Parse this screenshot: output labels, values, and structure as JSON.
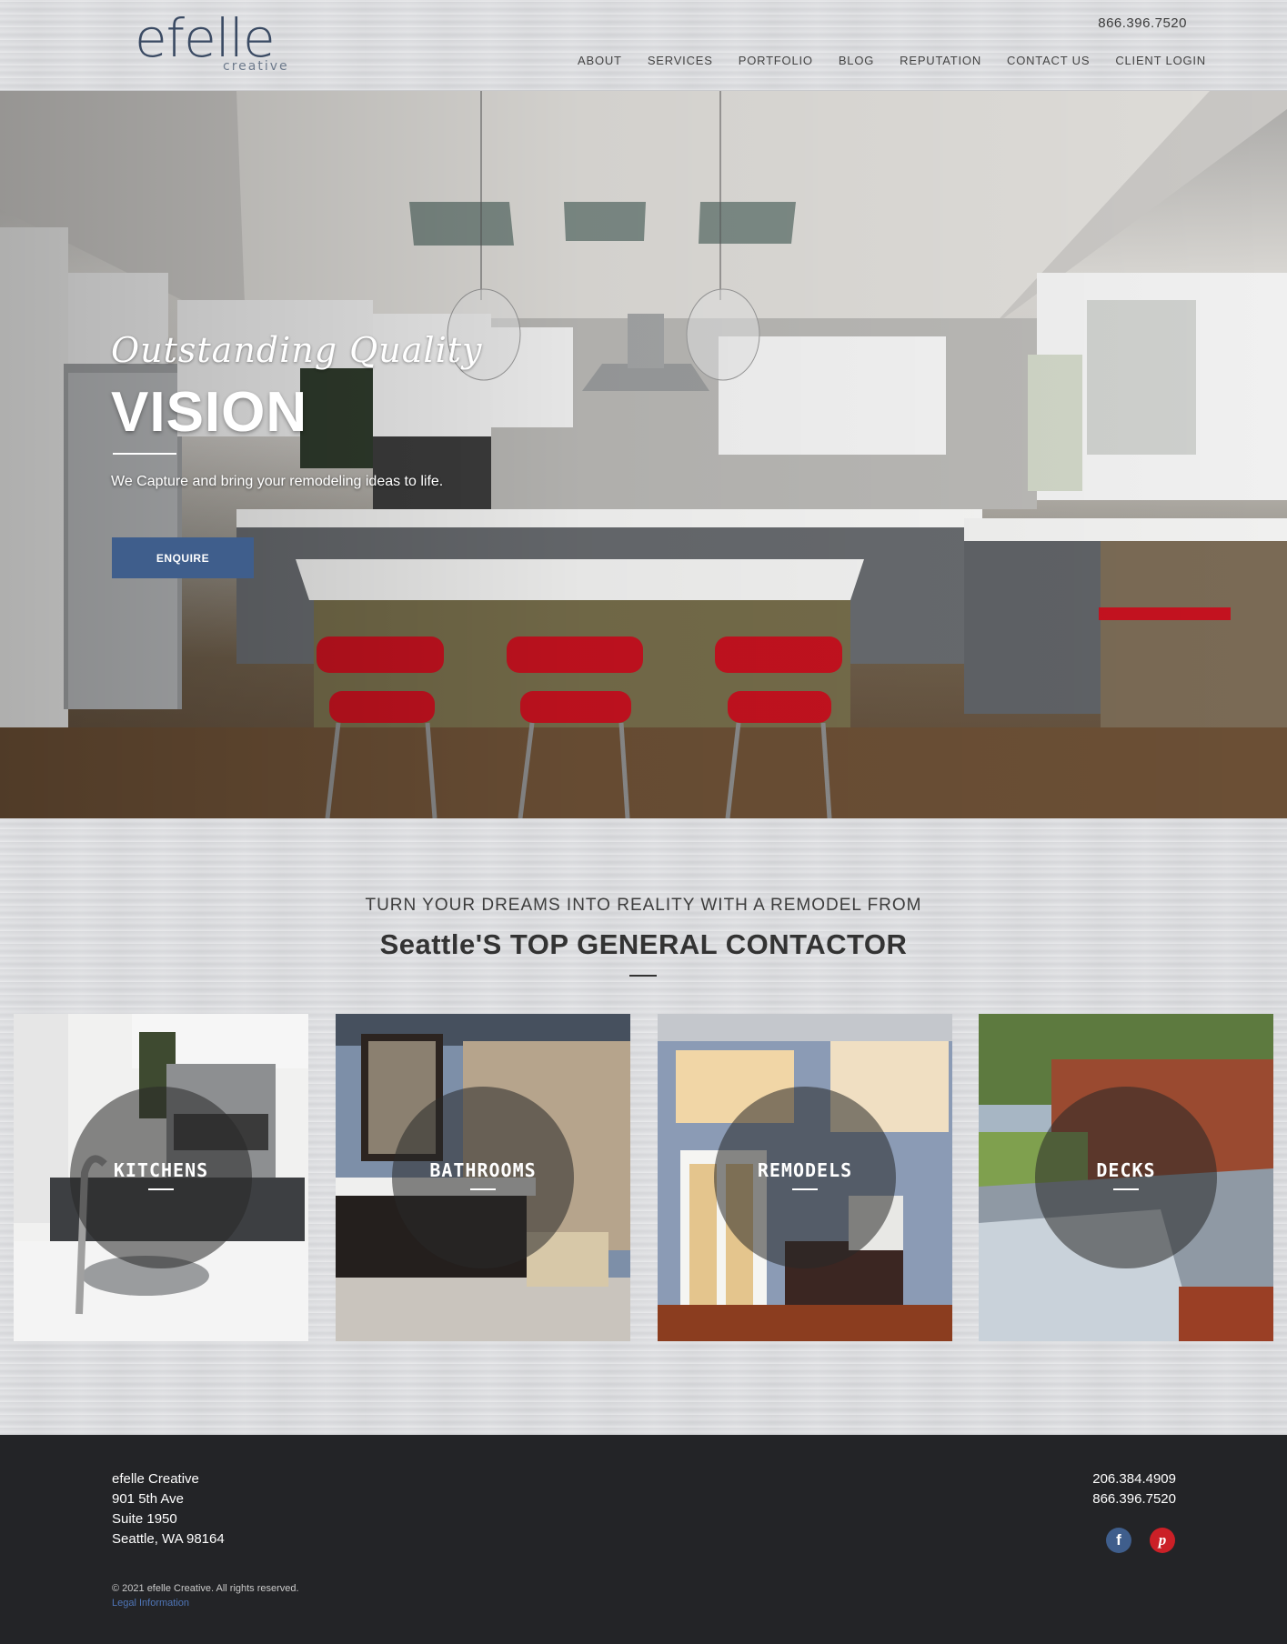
{
  "header": {
    "logo_main": "efelle",
    "logo_sub": "creative",
    "phone": "866.396.7520",
    "nav": [
      "ABOUT",
      "SERVICES",
      "PORTFOLIO",
      "BLOG",
      "REPUTATION",
      "CONTACT US",
      "CLIENT LOGIN"
    ]
  },
  "hero": {
    "script_line": "Outstanding Quality",
    "title": "VISION",
    "subtitle": "We Capture and bring your remodeling ideas to life.",
    "button": "ENQUIRE"
  },
  "section": {
    "kicker": "TURN YOUR DREAMS INTO REALITY WITH A REMODEL FROM",
    "title": "Seattle'S TOP GENERAL CONTACTOR",
    "cards": [
      "KITCHENS",
      "BATHROOMS",
      "REMODELS",
      "DECKS"
    ]
  },
  "footer": {
    "address": [
      "efelle Creative",
      "901 5th Ave",
      "Suite 1950",
      "Seattle, WA 98164"
    ],
    "phones": [
      "206.384.4909",
      "866.396.7520"
    ],
    "social": {
      "facebook": "f",
      "pinterest": "p"
    },
    "copyright": "© 2021 efelle Creative. All rights reserved.",
    "legal": "Legal Information"
  },
  "colors": {
    "accent": "#3f5e8c",
    "footer_bg": "#232427",
    "stool_red": "#c4121f"
  }
}
